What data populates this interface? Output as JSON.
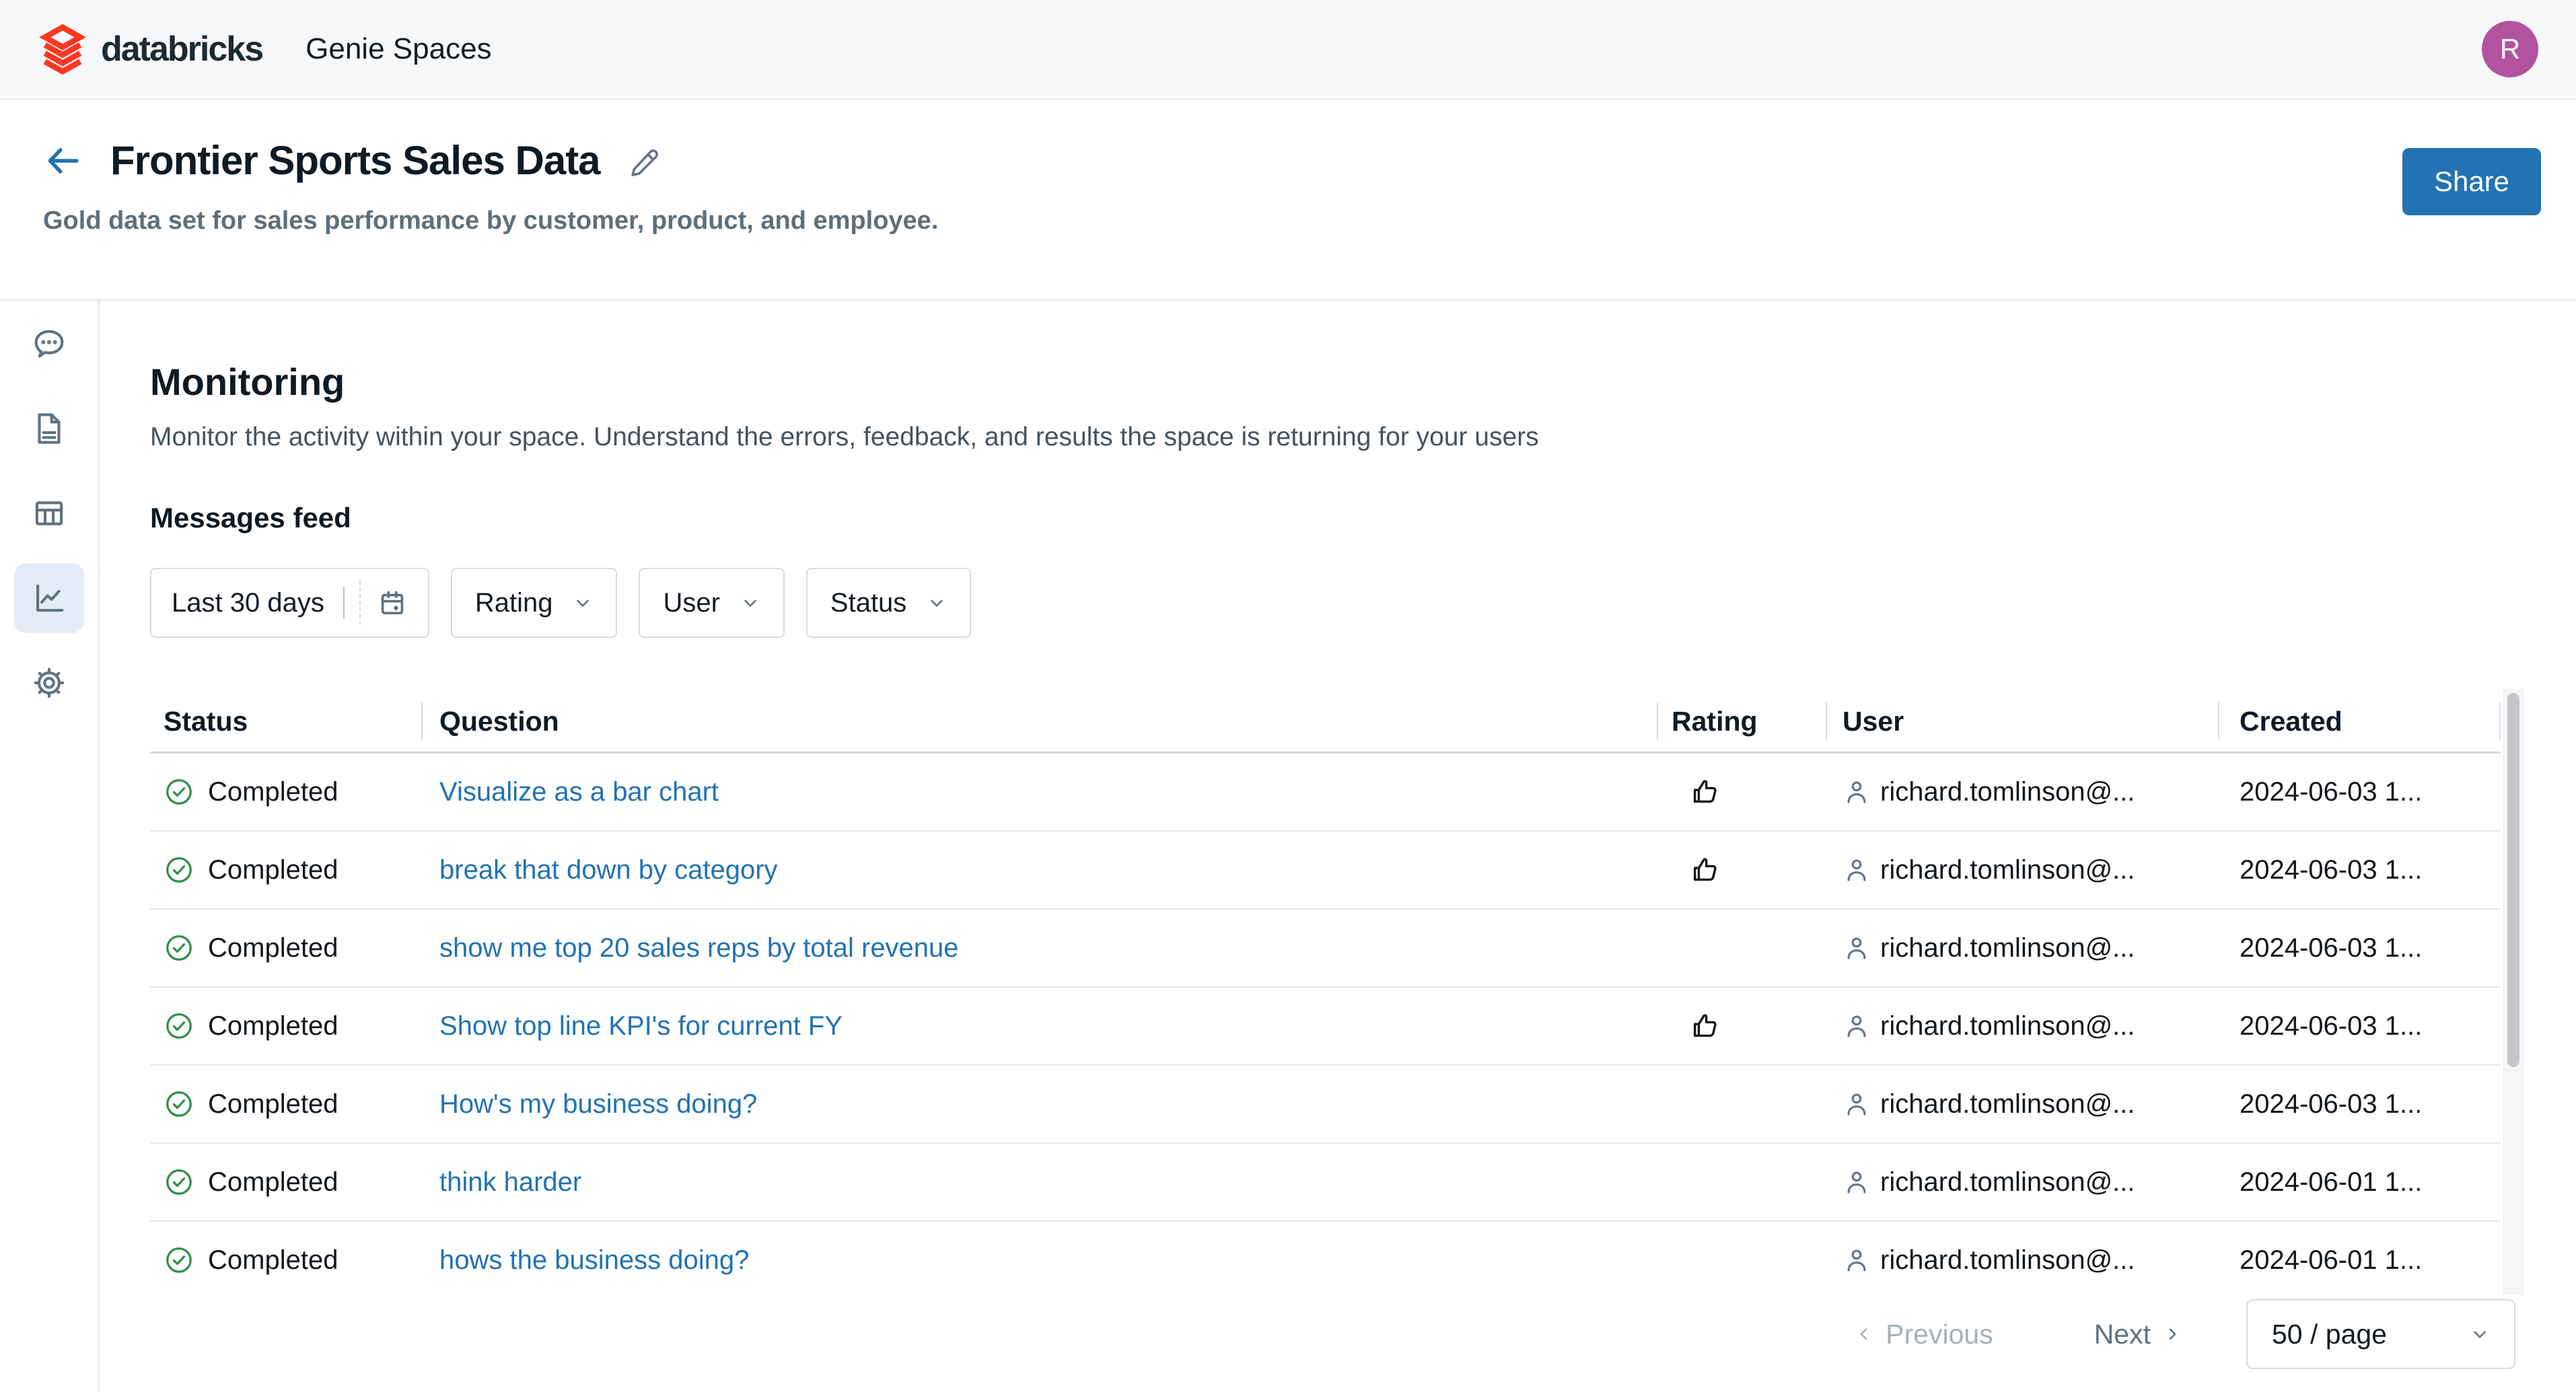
{
  "topbar": {
    "brand": "databricks",
    "app_title": "Genie Spaces",
    "avatar_initial": "R"
  },
  "header": {
    "title": "Frontier Sports Sales Data",
    "subtitle": "Gold data set for sales performance by customer, product, and employee.",
    "share_label": "Share"
  },
  "sidebar": {
    "items": [
      {
        "icon": "chat-bubble-icon",
        "active": false
      },
      {
        "icon": "document-icon",
        "active": false
      },
      {
        "icon": "table-icon",
        "active": false
      },
      {
        "icon": "line-chart-icon",
        "active": true
      },
      {
        "icon": "gear-icon",
        "active": false
      }
    ]
  },
  "monitoring": {
    "title": "Monitoring",
    "description": "Monitor the activity within your space. Understand the errors, feedback, and results the space is returning for your users",
    "feed_title": "Messages feed"
  },
  "filters": {
    "date_range": "Last 30 days",
    "rating_label": "Rating",
    "user_label": "User",
    "status_label": "Status"
  },
  "table": {
    "columns": {
      "status": "Status",
      "question": "Question",
      "rating": "Rating",
      "user": "User",
      "created": "Created"
    },
    "rows": [
      {
        "status": "Completed",
        "question": "Visualize as a bar chart",
        "rating": "thumbs-up",
        "user": "richard.tomlinson@...",
        "created": "2024-06-03 1..."
      },
      {
        "status": "Completed",
        "question": "break that down by category",
        "rating": "thumbs-up",
        "user": "richard.tomlinson@...",
        "created": "2024-06-03 1..."
      },
      {
        "status": "Completed",
        "question": "show me top 20 sales reps by total revenue",
        "rating": "",
        "user": "richard.tomlinson@...",
        "created": "2024-06-03 1..."
      },
      {
        "status": "Completed",
        "question": "Show top line KPI's for current FY",
        "rating": "thumbs-up",
        "user": "richard.tomlinson@...",
        "created": "2024-06-03 1..."
      },
      {
        "status": "Completed",
        "question": "How's my business doing?",
        "rating": "",
        "user": "richard.tomlinson@...",
        "created": "2024-06-03 1..."
      },
      {
        "status": "Completed",
        "question": "think harder",
        "rating": "",
        "user": "richard.tomlinson@...",
        "created": "2024-06-01 1..."
      },
      {
        "status": "Completed",
        "question": "hows the business doing?",
        "rating": "",
        "user": "richard.tomlinson@...",
        "created": "2024-06-01 1..."
      }
    ]
  },
  "pagination": {
    "previous_label": "Previous",
    "next_label": "Next",
    "page_size": "50 / page"
  },
  "colors": {
    "accent_blue": "#2272b4",
    "brand_red": "#ff3621",
    "success_green": "#2f8f46",
    "avatar_purple": "#b2539f"
  }
}
